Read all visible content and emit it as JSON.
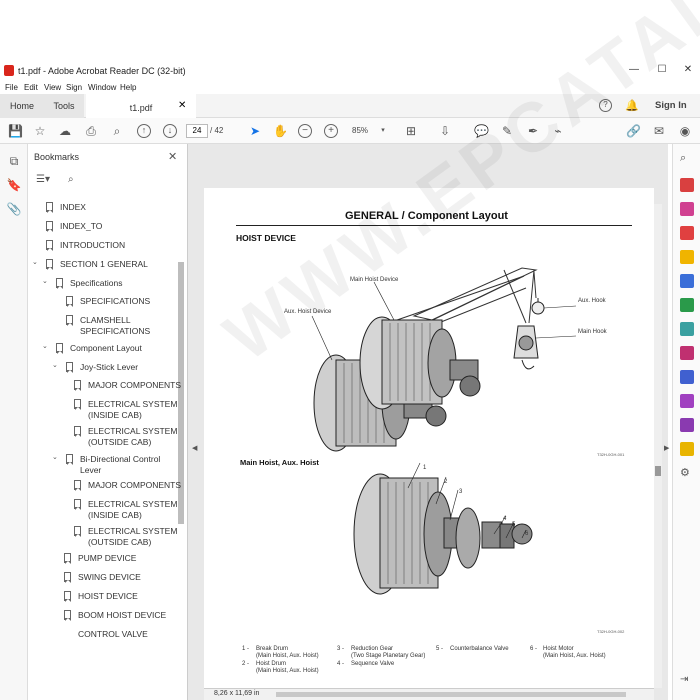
{
  "window": {
    "title": "t1.pdf - Adobe Acrobat Reader DC (32-bit)",
    "minimize": "—",
    "maximize": "☐",
    "close": "✕"
  },
  "menu": [
    "File",
    "Edit",
    "View",
    "Sign",
    "Window",
    "Help"
  ],
  "tabs": {
    "home": "Home",
    "tools": "Tools",
    "document": "t1.pdf",
    "close": "✕",
    "sign_in": "Sign In"
  },
  "toolbar": {
    "page_current": "24",
    "page_total": "/ 42",
    "zoom": "85%"
  },
  "bookmarks": {
    "title": "Bookmarks",
    "items": [
      {
        "label": "INDEX"
      },
      {
        "label": "INDEX_TO"
      },
      {
        "label": "INTRODUCTION"
      },
      {
        "label": "SECTION 1 GENERAL"
      },
      {
        "label": "Specifications"
      },
      {
        "label": "SPECIFICATIONS"
      },
      {
        "label": "CLAMSHELL"
      },
      {
        "label": "SPECIFICATIONS"
      },
      {
        "label": "Component Layout"
      },
      {
        "label": "Joy-Stick Lever"
      },
      {
        "label": "MAJOR COMPONENTS"
      },
      {
        "label": "ELECTRICAL SYSTEM"
      },
      {
        "label": "(INSIDE CAB)"
      },
      {
        "label": "ELECTRICAL SYSTEM"
      },
      {
        "label": "(OUTSIDE CAB)"
      },
      {
        "label": "Bi-Directional Control"
      },
      {
        "label": "Lever"
      },
      {
        "label": "MAJOR COMPONENTS"
      },
      {
        "label": "ELECTRICAL SYSTEM"
      },
      {
        "label": "(INSIDE CAB)"
      },
      {
        "label": "ELECTRICAL SYSTEM"
      },
      {
        "label": "(OUTSIDE CAB)"
      },
      {
        "label": "PUMP DEVICE"
      },
      {
        "label": "SWING DEVICE"
      },
      {
        "label": "HOIST DEVICE"
      },
      {
        "label": "BOOM HOIST DEVICE"
      },
      {
        "label": "CONTROL VALVE"
      }
    ]
  },
  "page": {
    "header": "GENERAL / Component Layout",
    "section1": "HOIST DEVICE",
    "section2": "Main Hoist, Aux. Hoist",
    "labels": {
      "main_hoist": "Main Hoist Device",
      "aux_hoist": "Aux. Hoist Device",
      "aux_hook": "Aux. Hook",
      "main_hook": "Main Hook",
      "code1": "T32H-0GH-001",
      "code2": "T32H-0GH-002",
      "n1": "1",
      "n2": "2",
      "n3": "3",
      "n4": "4",
      "n5": "5",
      "n6": "6"
    },
    "legend": [
      {
        "num": "1 -",
        "text": "Break Drum",
        "sub": "(Main Hoist, Aux. Hoist)"
      },
      {
        "num": "2 -",
        "text": "Hoist Drum",
        "sub": "(Main Hoist, Aux. Hoist)"
      },
      {
        "num": "3 -",
        "text": "Reduction Gear",
        "sub": "(Two Stage Planetary Gear)"
      },
      {
        "num": "4 -",
        "text": "Sequence Valve",
        "sub": ""
      },
      {
        "num": "5 -",
        "text": "Counterbalance Valve",
        "sub": ""
      },
      {
        "num": "6 -",
        "text": "Hoist Motor",
        "sub": "(Main Hoist, Aux. Hoist)"
      }
    ],
    "page_size": "8,26 x 11,69 in",
    "watermark": "WWW.EPCATALOGS.COM"
  },
  "colors": {
    "accent": "#1473e6",
    "red": "#d9261c"
  }
}
